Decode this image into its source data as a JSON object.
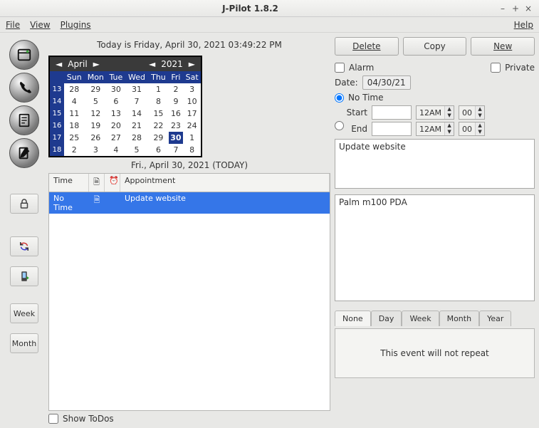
{
  "window": {
    "title": "J-Pilot 1.8.2"
  },
  "menu": {
    "file": "File",
    "view": "View",
    "plugins": "Plugins",
    "help": "Help"
  },
  "today_label": "Today is Friday, April 30, 2021 03:49:22 PM",
  "cal": {
    "month": "April",
    "year": "2021",
    "wk_col": "",
    "days": [
      "Sun",
      "Mon",
      "Tue",
      "Wed",
      "Thu",
      "Fri",
      "Sat"
    ],
    "rows": [
      {
        "wk": "13",
        "cells": [
          "28",
          "29",
          "30",
          "31",
          "1",
          "2",
          "3"
        ]
      },
      {
        "wk": "14",
        "cells": [
          "4",
          "5",
          "6",
          "7",
          "8",
          "9",
          "10"
        ]
      },
      {
        "wk": "15",
        "cells": [
          "11",
          "12",
          "13",
          "14",
          "15",
          "16",
          "17"
        ]
      },
      {
        "wk": "16",
        "cells": [
          "18",
          "19",
          "20",
          "21",
          "22",
          "23",
          "24"
        ]
      },
      {
        "wk": "17",
        "cells": [
          "25",
          "26",
          "27",
          "28",
          "29",
          "30",
          "1"
        ]
      },
      {
        "wk": "18",
        "cells": [
          "2",
          "3",
          "4",
          "5",
          "6",
          "7",
          "8"
        ]
      }
    ],
    "today_row": 4,
    "today_col": 5
  },
  "date_sub": "Fri., April 30, 2021 (TODAY)",
  "evt": {
    "head_time": "Time",
    "head_appt": "Appointment",
    "row_time": "No Time",
    "row_appt": "Update website"
  },
  "showtodo_label": "Show ToDos",
  "left_buttons": {
    "week": "Week",
    "month": "Month"
  },
  "actions": {
    "delete": "Delete",
    "copy": "Copy",
    "new": "New"
  },
  "alarm_label": "Alarm",
  "private_label": "Private",
  "date_label": "Date:",
  "date_value": "04/30/21",
  "notime_label": "No Time",
  "start_label": "Start",
  "end_label": "End",
  "ampm_start": "12AM",
  "ampm_end": "12AM",
  "mm_start": "00",
  "mm_end": "00",
  "desc_text": "Update website",
  "note_text": "Palm m100 PDA",
  "tabs": {
    "none": "None",
    "day": "Day",
    "week": "Week",
    "month": "Month",
    "year": "Year"
  },
  "tab_body": "This event will not repeat"
}
